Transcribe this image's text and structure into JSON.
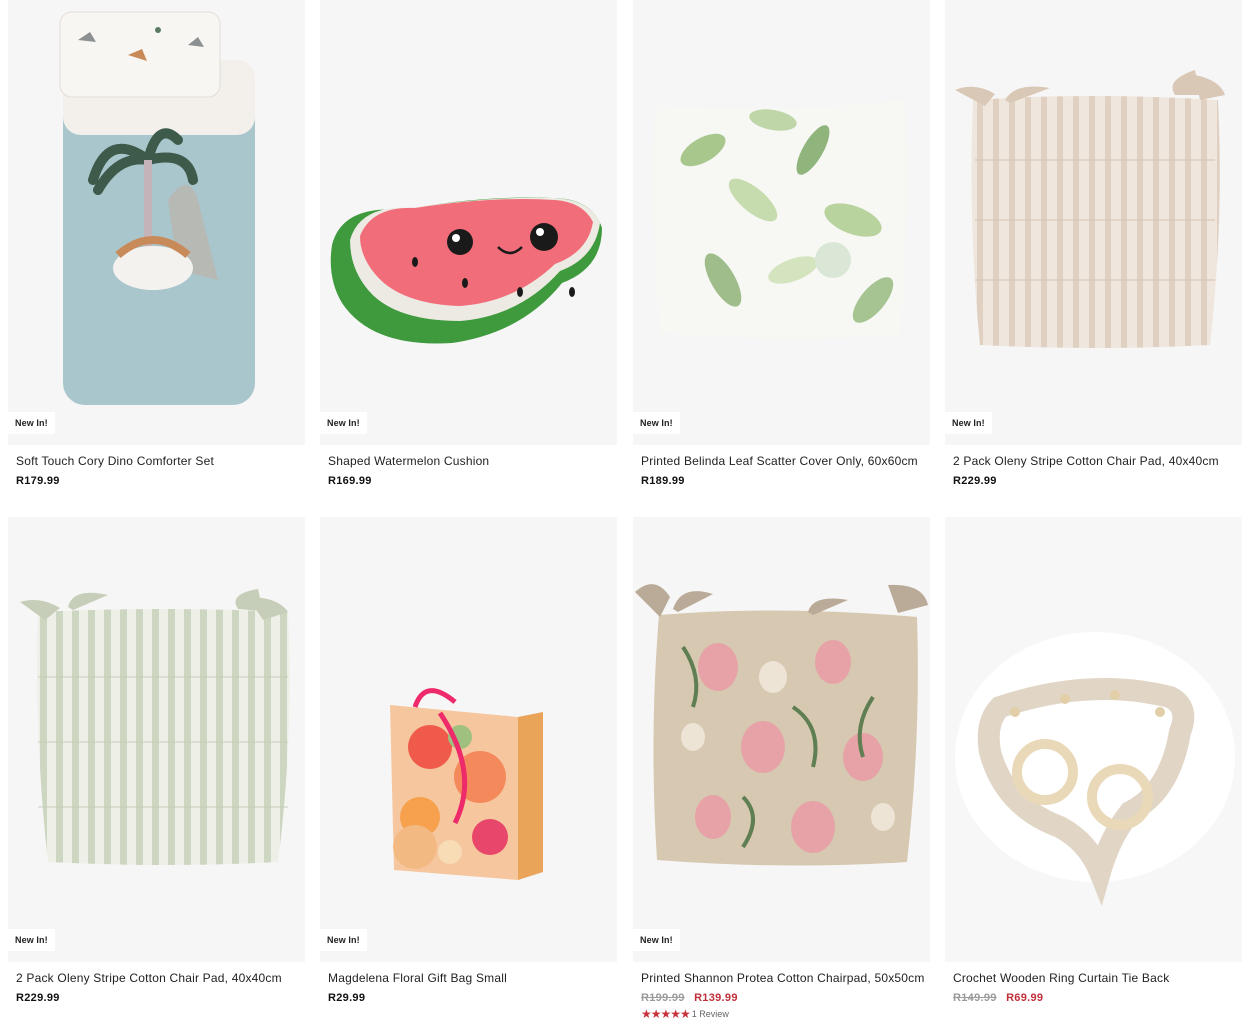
{
  "products": [
    {
      "name": "Soft Touch Cory Dino Comforter Set",
      "badge": "New In!",
      "price": "R179.99",
      "image_icon": "dino-comforter-image"
    },
    {
      "name": "Shaped Watermelon Cushion",
      "badge": "New In!",
      "price": "R169.99",
      "image_icon": "watermelon-cushion-image"
    },
    {
      "name": "Printed Belinda Leaf Scatter Cover Only, 60x60cm",
      "badge": "New In!",
      "price": "R189.99",
      "image_icon": "leaf-scatter-cover-image"
    },
    {
      "name": "2 Pack Oleny Stripe Cotton Chair Pad, 40x40cm",
      "badge": "New In!",
      "price": "R229.99",
      "image_icon": "beige-stripe-chair-pad-image"
    },
    {
      "name": "2 Pack Oleny Stripe Cotton Chair Pad, 40x40cm",
      "badge": "New In!",
      "price": "R229.99",
      "image_icon": "green-stripe-chair-pad-image"
    },
    {
      "name": "Magdelena Floral Gift Bag Small",
      "badge": "New In!",
      "price": "R29.99",
      "image_icon": "floral-gift-bag-image"
    },
    {
      "name": "Printed Shannon Protea Cotton Chairpad, 50x50cm",
      "badge": "New In!",
      "was_price": "R199.99",
      "sale_price": "R139.99",
      "stars": "★★★★★",
      "rating": 5,
      "review_text": "1 Review",
      "image_icon": "protea-chairpad-image"
    },
    {
      "name": "Crochet Wooden Ring Curtain Tie Back",
      "was_price": "R149.99",
      "sale_price": "R69.99",
      "image_icon": "crochet-tie-back-image"
    }
  ],
  "colors": {
    "sale": "#c0303a",
    "was": "#9a9a9a",
    "card_bg": "#f6f6f6",
    "stars": "#c8323c"
  }
}
